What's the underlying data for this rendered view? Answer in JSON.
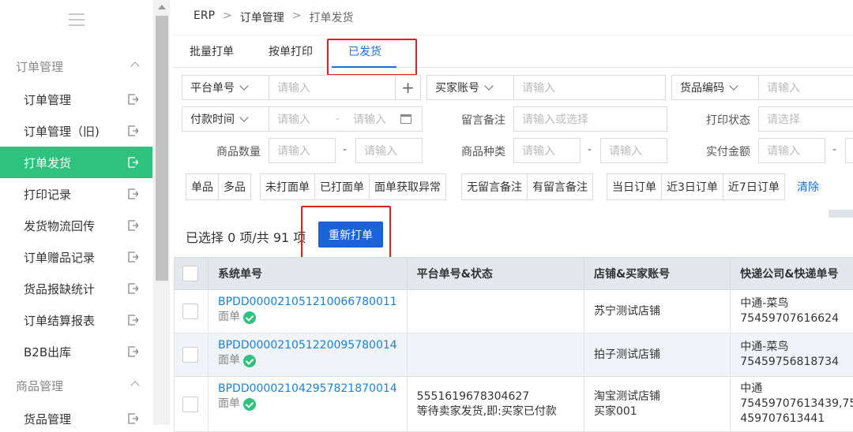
{
  "sidebar": {
    "groups": [
      {
        "label": "订单管理"
      },
      {
        "label": "商品管理"
      }
    ],
    "items": [
      {
        "label": "订单管理"
      },
      {
        "label": "订单管理（旧)"
      },
      {
        "label": "打单发货"
      },
      {
        "label": "打印记录"
      },
      {
        "label": "发货物流回传"
      },
      {
        "label": "订单赠品记录"
      },
      {
        "label": "货品报缺统计"
      },
      {
        "label": "订单结算报表"
      },
      {
        "label": "B2B出库"
      },
      {
        "label": "货品管理"
      }
    ]
  },
  "breadcrumb": [
    "ERP",
    "订单管理",
    "打单发货"
  ],
  "tabs": [
    "批量打单",
    "按单打印",
    "已发货"
  ],
  "filters": {
    "platform_no": {
      "label": "平台单号",
      "placeholder": "请输入"
    },
    "buyer_account": {
      "label": "买家账号",
      "placeholder": "请输入"
    },
    "goods_code": {
      "label": "货品编码",
      "placeholder": "请输入"
    },
    "pay_time": {
      "label": "付款时间",
      "placeholder_start": "请输入",
      "separator": "-",
      "placeholder_end": "请输入"
    },
    "remark": {
      "label": "留言备注",
      "placeholder": "请输入或选择"
    },
    "print_status": {
      "label": "打印状态",
      "placeholder": "请选择"
    },
    "goods_qty": {
      "label": "商品数量",
      "placeholder": "请输入"
    },
    "goods_kind": {
      "label": "商品种类",
      "placeholder": "请输入"
    },
    "paid_amount": {
      "label": "实付金额",
      "placeholder": "请输入"
    },
    "dash": "-"
  },
  "quick_filters": {
    "group1": [
      "单品",
      "多品"
    ],
    "group2": [
      "未打面单",
      "已打面单",
      "面单获取异常"
    ],
    "group3": [
      "无留言备注",
      "有留言备注"
    ],
    "group4": [
      "当日订单",
      "近3日订单",
      "近7日订单"
    ],
    "clear": "清除"
  },
  "selection_info": "已选择 0 项/共 91 项",
  "reprint_button": "重新打单",
  "table": {
    "headers": [
      "系统单号",
      "平台单号&状态",
      "店铺&买家账号",
      "快递公司&快递单号"
    ],
    "rows": [
      {
        "sys_no": "BPDD000021051210066780011",
        "type": "面单",
        "platform_no": "",
        "platform_status": "",
        "shop": "苏宁测试店铺",
        "buyer": "",
        "express_company": "中通-菜鸟",
        "express_no": "75459707616624"
      },
      {
        "sys_no": "BPDD000021051220095780014",
        "type": "面单",
        "platform_no": "",
        "platform_status": "",
        "shop": "拍子测试店铺",
        "buyer": "",
        "express_company": "中通-菜鸟",
        "express_no": "75459756818734"
      },
      {
        "sys_no": "BPDD000021042957821870014",
        "type": "面单",
        "platform_no": "5551619678304627",
        "platform_status": "等待卖家发货,即:买家已付款",
        "shop": "淘宝测试店铺",
        "buyer": "买家001",
        "express_company": "中通",
        "express_no": "75459707613439,75459707613441"
      }
    ]
  }
}
